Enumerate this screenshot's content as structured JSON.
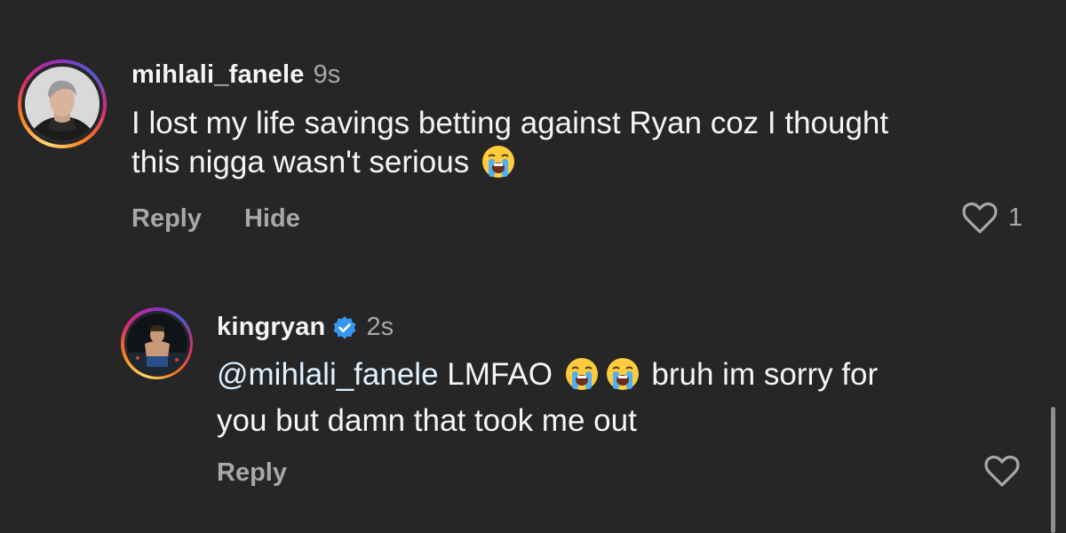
{
  "comments": [
    {
      "username": "mihlali_fanele",
      "time": "9s",
      "text_line1": "I lost my life savings betting against Ryan coz I thought",
      "text_line2": "this nigga wasn't serious",
      "reply_label": "Reply",
      "hide_label": "Hide",
      "like_count": "1",
      "emoji": "loudly-crying-face"
    },
    {
      "username": "kingryan",
      "verified": true,
      "time": "2s",
      "mention": "@mihlali_fanele",
      "text_a": "LMFAO",
      "text_b": "bruh im sorry for",
      "text_line2": "you but damn that took me out",
      "reply_label": "Reply",
      "emoji": "loudly-crying-face"
    }
  ],
  "colors": {
    "background": "#262626",
    "primary_text": "#f5f5f5",
    "secondary_text": "#a8a8a8",
    "verified_blue": "#3797f0",
    "mention": "#e0f1ff"
  }
}
